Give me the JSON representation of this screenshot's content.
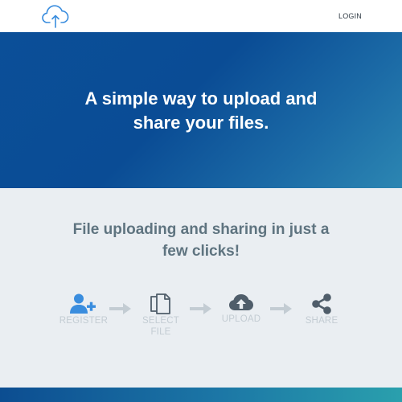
{
  "header": {
    "logo_icon": "cloud-upload-icon",
    "login_label": "LOGIN"
  },
  "hero": {
    "title_line1": "A simple way to upload and",
    "title_line2": "share your files."
  },
  "features": {
    "title_line1": "File uploading and sharing in just a",
    "title_line2": "few clicks!",
    "steps": [
      {
        "icon": "add-user-icon",
        "label_line1": "REGISTER",
        "label_line2": ""
      },
      {
        "icon": "copy-files-icon",
        "label_line1": "SELECT",
        "label_line2": "FILE"
      },
      {
        "icon": "cloud-upload-icon",
        "label_line1": "UPLOAD",
        "label_line2": ""
      },
      {
        "icon": "share-icon",
        "label_line1": "SHARE",
        "label_line2": ""
      }
    ]
  },
  "colors": {
    "accent": "#3a8dde",
    "hero_gradient_start": "#0b4f98",
    "hero_gradient_end": "#2c86b2",
    "features_bg": "#eaeef2",
    "icon_gray": "#4f5d6a",
    "arrow_gray": "#c3ccd3"
  }
}
